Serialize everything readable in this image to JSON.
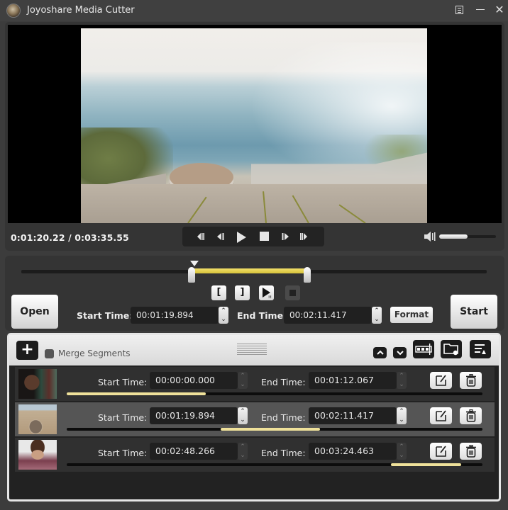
{
  "window": {
    "title": "Joyoshare Media Cutter",
    "menu_icon": "menu-icon",
    "minimize_icon": "minimize-icon",
    "close_icon": "close-icon"
  },
  "player": {
    "current_time": "0:01:20.22",
    "total_time": "0:03:35.55",
    "timecode": "0:01:20.22 / 0:03:35.55",
    "volume_fraction": 0.5,
    "transport": [
      {
        "name": "previous-frame-start",
        "icon": "skip-back-icon"
      },
      {
        "name": "step-back",
        "icon": "step-back-icon"
      },
      {
        "name": "play",
        "icon": "play-icon"
      },
      {
        "name": "stop",
        "icon": "stop-icon"
      },
      {
        "name": "step-forward",
        "icon": "step-forward-icon"
      },
      {
        "name": "next-frame-end",
        "icon": "skip-forward-icon"
      }
    ]
  },
  "trim": {
    "open_label": "Open",
    "start_label": "Start",
    "start_time_label": "Start Time:",
    "end_time_label": "End Time:",
    "start_time_value": "00:01:19.894",
    "end_time_value": "00:02:11.417",
    "format_label": "Format",
    "duration_seconds": 215.55,
    "range_start_seconds": 79.894,
    "range_end_seconds": 131.417,
    "playhead_seconds": 80.22,
    "mini_buttons": [
      {
        "name": "set-start-button",
        "glyph": "["
      },
      {
        "name": "set-end-button",
        "glyph": "]"
      },
      {
        "name": "preview-segment-button",
        "icon": "play-cursor-icon"
      },
      {
        "name": "stop-preview-button",
        "icon": "stop-icon",
        "disabled": true
      }
    ]
  },
  "segments": {
    "add_label": "+",
    "merge_label": "Merge Segments",
    "merge_checked": false,
    "toolbar_icons": [
      "move-up-icon",
      "move-down-icon",
      "film-strip-icon",
      "output-folder-icon",
      "edit-list-icon"
    ],
    "start_label": "Start Time:",
    "end_label": "End Time:",
    "rows": [
      {
        "start": "00:00:00.000",
        "end": "00:01:12.067",
        "start_seconds": 0,
        "end_seconds": 72.067,
        "selected": false
      },
      {
        "start": "00:01:19.894",
        "end": "00:02:11.417",
        "start_seconds": 79.894,
        "end_seconds": 131.417,
        "selected": true
      },
      {
        "start": "00:02:48.266",
        "end": "00:03:24.463",
        "start_seconds": 168.266,
        "end_seconds": 204.463,
        "selected": false
      }
    ]
  }
}
